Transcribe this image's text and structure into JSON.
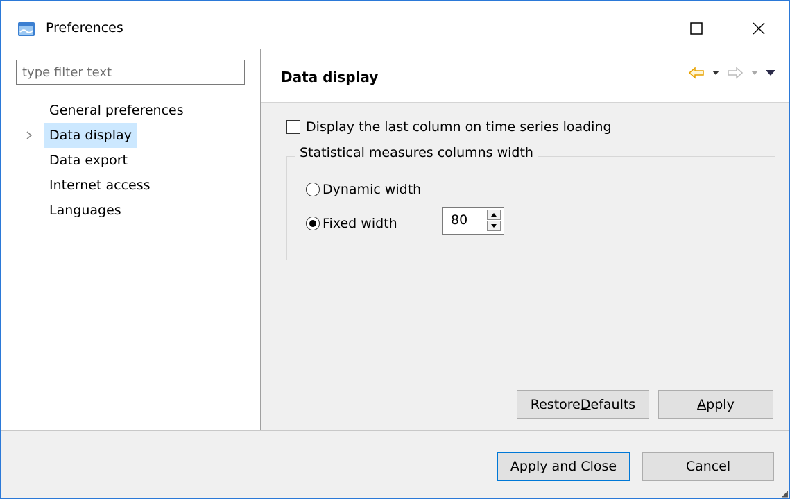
{
  "window": {
    "title": "Preferences",
    "controls": [
      "minimize-icon",
      "maximize-icon",
      "close-icon"
    ]
  },
  "sidebar": {
    "filter_placeholder": "type filter text",
    "filter_value": "",
    "items": [
      {
        "label": "General preferences",
        "selected": false
      },
      {
        "label": "Data display",
        "selected": true,
        "expandable": true
      },
      {
        "label": "Data export",
        "selected": false
      },
      {
        "label": "Internet access",
        "selected": false
      },
      {
        "label": "Languages",
        "selected": false
      }
    ]
  },
  "page": {
    "title": "Data display",
    "nav_icons": [
      "back-arrow-icon",
      "back-dropdown-icon",
      "forward-arrow-icon",
      "forward-dropdown-icon",
      "view-menu-icon"
    ],
    "checkbox_label": "Display the last column on time series loading",
    "checkbox_checked": false,
    "group_label": "Statistical measures columns width",
    "radio_dynamic_label": "Dynamic width",
    "radio_fixed_label": "Fixed width",
    "radio_selected": "Fixed width",
    "width_value": "80",
    "restore_prefix": "Restore ",
    "restore_mnemonic": "D",
    "restore_suffix": "efaults",
    "apply_mnemonic": "A",
    "apply_suffix": "pply"
  },
  "footer": {
    "apply_close_label": "Apply and Close",
    "cancel_label": "Cancel"
  },
  "colors": {
    "accent": "#0078d7",
    "selection": "#cce8ff",
    "back_arrow": "#e8a200"
  }
}
